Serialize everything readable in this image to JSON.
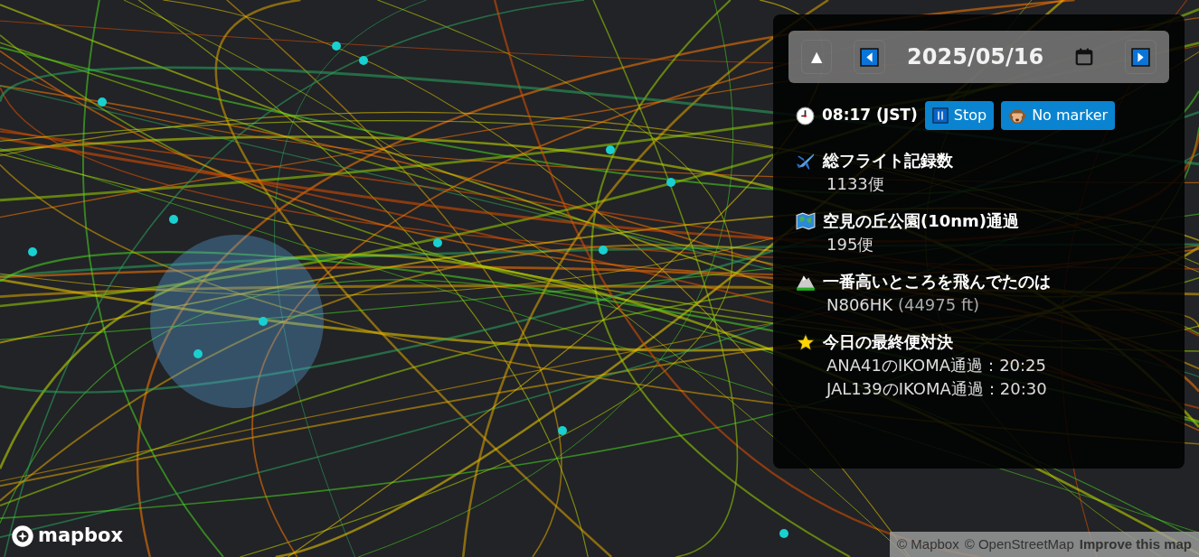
{
  "date_nav": {
    "up": "▲",
    "date": "2025/05/16"
  },
  "clock": {
    "time": "08:17 (JST)"
  },
  "buttons": [
    {
      "label": "Stop"
    },
    {
      "label": "No marker"
    }
  ],
  "stats": [
    {
      "title": "総フライト記録数",
      "lines": [
        {
          "main": "1133便"
        }
      ]
    },
    {
      "title": "空見の丘公園(10nm)通過",
      "lines": [
        {
          "main": "195便"
        }
      ]
    },
    {
      "title": "一番高いところを飛んでたのは",
      "lines": [
        {
          "main": "N806HK",
          "note": "(44975 ft)"
        }
      ]
    },
    {
      "title": "今日の最終便対決",
      "lines": [
        {
          "main": "ANA41のIKOMA通過：20:25"
        },
        {
          "main": "JAL139のIKOMA通過：20:30"
        }
      ]
    }
  ],
  "map": {
    "logo": "mapbox",
    "attribution": [
      "© Mapbox",
      "© OpenStreetMap"
    ],
    "improve_link": "Improve this map"
  }
}
